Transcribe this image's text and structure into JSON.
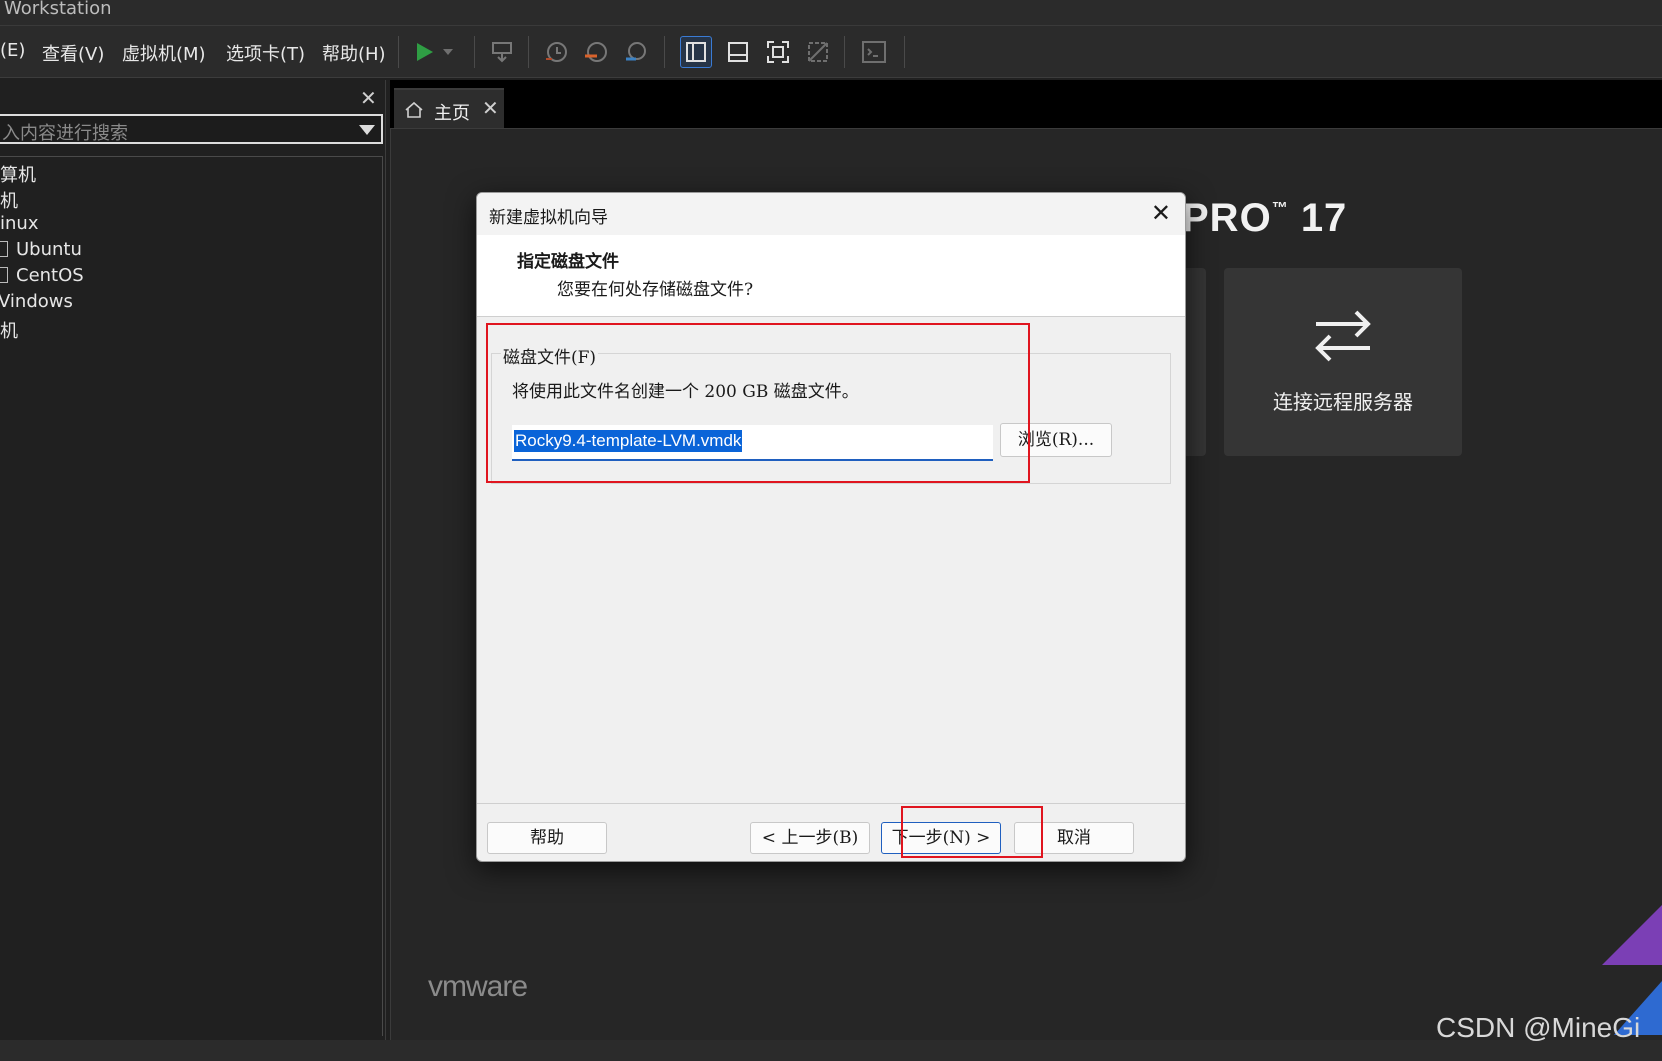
{
  "window": {
    "title": "Workstation"
  },
  "menu": [
    "(E)",
    "查看(V)",
    "虚拟机(M)",
    "选项卡(T)",
    "帮助(H)"
  ],
  "sidebar": {
    "search_placeholder": "入内容进行搜索",
    "items": [
      {
        "label": "算机"
      },
      {
        "label": "机"
      },
      {
        "label": "inux"
      },
      {
        "label": "Ubuntu"
      },
      {
        "label": "CentOS"
      },
      {
        "label": "Vindows"
      },
      {
        "label": "机"
      }
    ]
  },
  "tabs": [
    {
      "label": "主页"
    }
  ],
  "home": {
    "product": "PRO",
    "tm": "™",
    "version": "17",
    "connect_remote": "连接远程服务器",
    "logo": "vmware"
  },
  "dialog": {
    "title": "新建虚拟机向导",
    "heading": "指定磁盘文件",
    "subheading": "您要在何处存储磁盘文件?",
    "group_label": "磁盘文件(F)",
    "description": "将使用此文件名创建一个 200 GB 磁盘文件。",
    "file_value": "Rocky9.4-template-LVM.vmdk",
    "browse": "浏览(R)...",
    "help": "帮助",
    "back": "< 上一步(B)",
    "next": "下一步(N) >",
    "cancel": "取消"
  },
  "watermark": "CSDN @MineGi",
  "colors": {
    "accent": "#0a64d8",
    "highlight": "#e0151f",
    "play": "#2f9e44"
  }
}
